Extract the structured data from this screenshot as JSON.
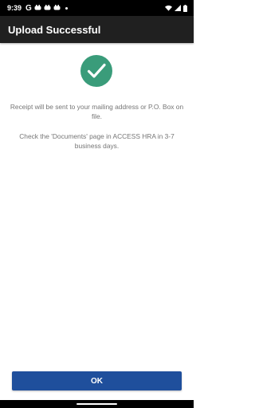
{
  "status_bar": {
    "time": "9:39",
    "g_icon_label": "G"
  },
  "app_bar": {
    "title": "Upload Successful"
  },
  "content": {
    "success_icon": "check-circle-icon",
    "message_1": "Receipt will be sent to your mailing address or P.O. Box on file.",
    "message_2": "Check the 'Documents' page in ACCESS HRA in 3-7 business days."
  },
  "actions": {
    "ok_label": "OK"
  },
  "colors": {
    "success_green": "#3a9c7a",
    "button_blue": "#1f4f9c",
    "app_bar": "#202020"
  }
}
